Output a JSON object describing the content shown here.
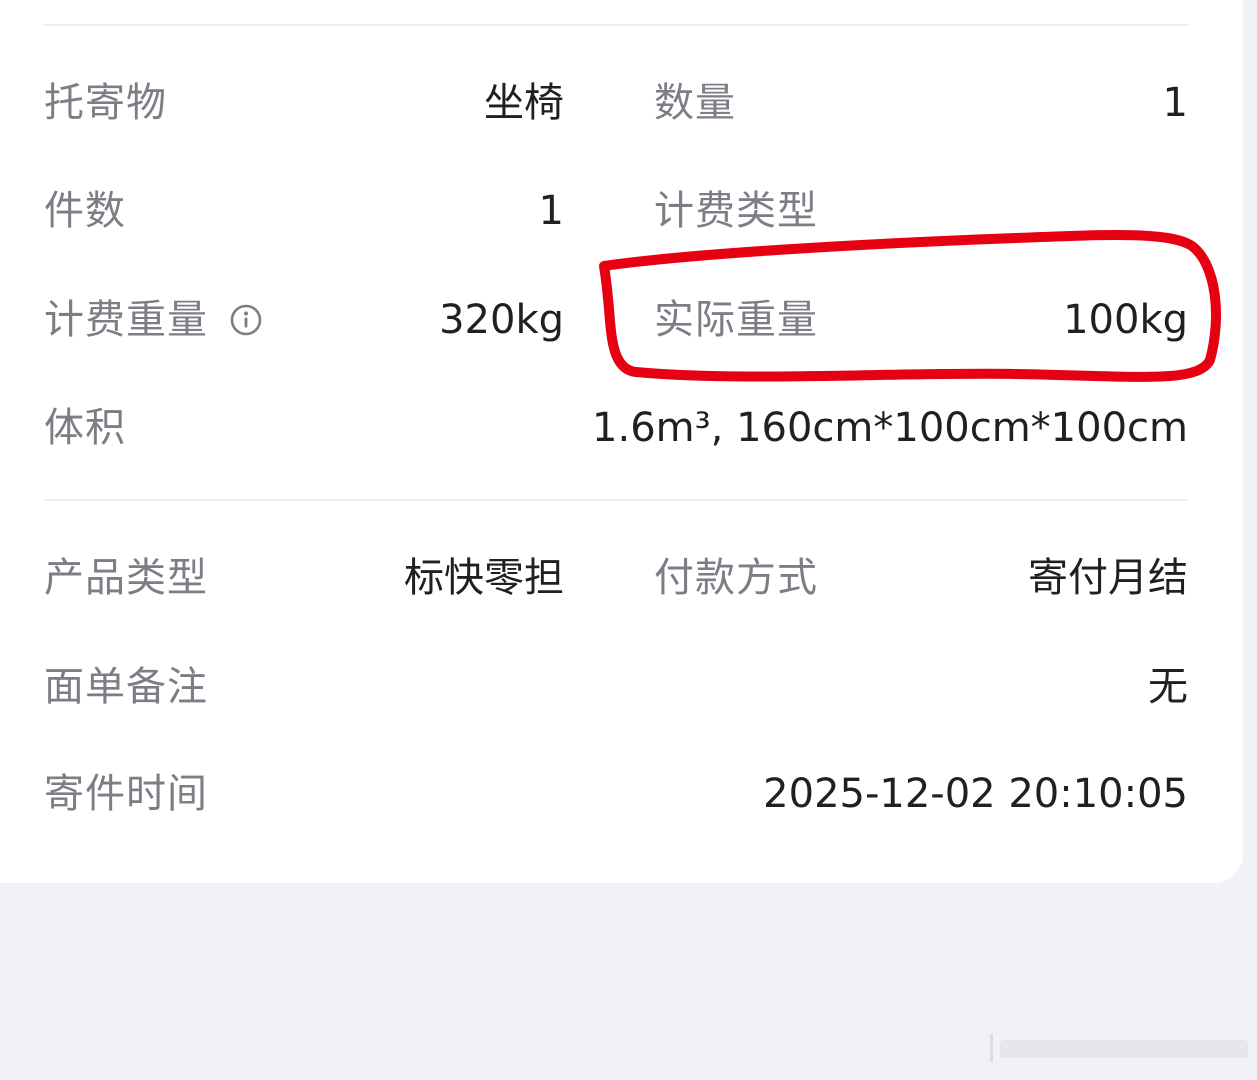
{
  "rows": {
    "item_label": "托寄物",
    "item_value": "坐椅",
    "quantity_label": "数量",
    "quantity_value": "1",
    "pieces_label": "件数",
    "pieces_value": "1",
    "billing_type_label": "计费类型",
    "billing_weight_label": "计费重量",
    "billing_weight_value": "320kg",
    "actual_weight_label": "实际重量",
    "actual_weight_value": "100kg",
    "volume_label": "体积",
    "volume_value": "1.6m³, 160cm*100cm*100cm",
    "product_type_label": "产品类型",
    "product_type_value": "标快零担",
    "payment_label": "付款方式",
    "payment_value": "寄付月结",
    "remark_label": "面单备注",
    "remark_value": "无",
    "send_time_label": "寄件时间",
    "send_time_value": "2025-12-02 20:10:05"
  },
  "icons": {
    "info": "info-circle-icon"
  },
  "colors": {
    "highlight": "#e60012",
    "label": "#7c7e86",
    "value": "#1f2024",
    "background": "#f1f2f7"
  }
}
